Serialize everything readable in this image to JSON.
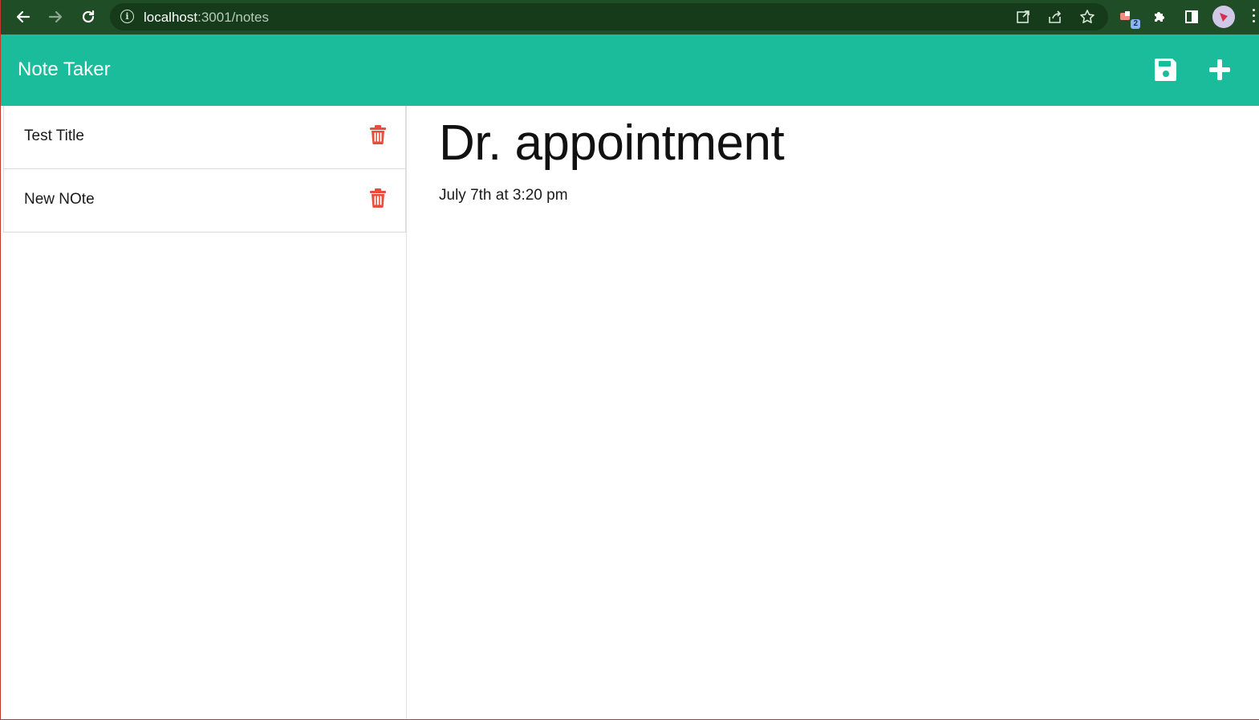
{
  "browser": {
    "url_host": "localhost",
    "url_path": ":3001/notes",
    "extension_badge": "2"
  },
  "app": {
    "brand": "Note Taker",
    "accent_color": "#1abc9c",
    "delete_color": "#e74c3c",
    "icons": {
      "save": "floppy-disk-icon",
      "new": "plus-icon",
      "delete": "trash-icon"
    }
  },
  "notes_list": [
    {
      "title": "Test Title"
    },
    {
      "title": "New NOte"
    }
  ],
  "active_note": {
    "title": "Dr. appointment",
    "text": "July 7th at 3:20 pm"
  }
}
